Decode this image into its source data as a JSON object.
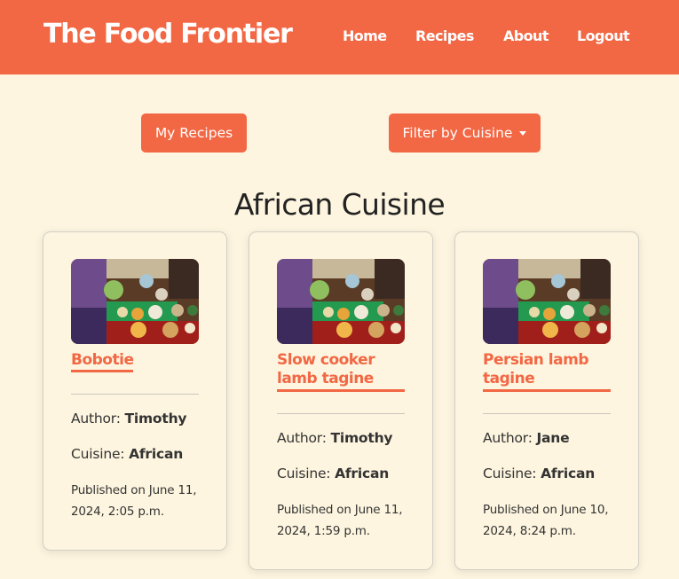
{
  "brand": "The Food Frontier",
  "nav": {
    "home": "Home",
    "recipes": "Recipes",
    "about": "About",
    "logout": "Logout"
  },
  "toolbar": {
    "my_recipes": "My Recipes",
    "filter": "Filter by Cuisine"
  },
  "page_title": "African Cuisine",
  "labels": {
    "author": "Author:",
    "cuisine": "Cuisine:"
  },
  "recipes": [
    {
      "title": "Bobotie",
      "author": "Timothy",
      "cuisine": "African",
      "published": "Published on June 11, 2024, 2:05 p.m."
    },
    {
      "title": "Slow cooker lamb tagine",
      "author": "Timothy",
      "cuisine": "African",
      "published": "Published on June 11, 2024, 1:59 p.m."
    },
    {
      "title": "Persian lamb tagine",
      "author": "Jane",
      "cuisine": "African",
      "published": "Published on June 10, 2024, 8:24 p.m."
    }
  ],
  "colors": {
    "accent": "#f26744",
    "background": "#fdf5df"
  }
}
